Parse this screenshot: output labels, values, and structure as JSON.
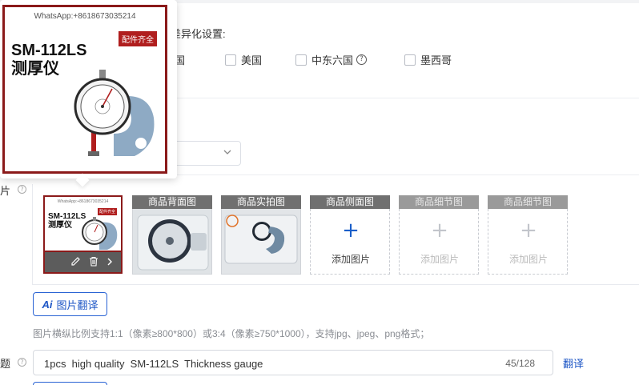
{
  "diff_settings": {
    "label": "差异化设置:"
  },
  "countries": [
    {
      "label": "韩国",
      "has_help": false
    },
    {
      "label": "美国",
      "has_help": false
    },
    {
      "label": "中东六国",
      "has_help": true
    },
    {
      "label": "墨西哥",
      "has_help": false
    }
  ],
  "side_labels": {
    "images": "片",
    "title": "题"
  },
  "image_slots": [
    {
      "label": "商品背面图",
      "state": "photo"
    },
    {
      "label": "商品实拍图",
      "state": "photo"
    },
    {
      "label": "商品侧面图",
      "state": "add",
      "action": "添加图片"
    },
    {
      "label": "商品细节图",
      "state": "disabled",
      "action": "添加图片"
    },
    {
      "label": "商品细节图",
      "state": "disabled",
      "action": "添加图片"
    }
  ],
  "main_thumb": {
    "watermark": "WhatsApp:+8618673035214",
    "badge": "配件齐全",
    "model_line1": "SM-112LS",
    "model_line2": "测厚仪"
  },
  "preview_popup": {
    "watermark": "WhatsApp:+8618673035214",
    "badge": "配件齐全",
    "model_line1": "SM-112LS",
    "model_line2": "测厚仪"
  },
  "ai_translate": {
    "ai_mark": "Ai",
    "label": "图片翻译"
  },
  "image_hint": "图片横纵比例支持1:1（像素≥800*800）或3:4（像素≥750*1000），支持jpg、jpeg、png格式；",
  "title_field": {
    "value": "1pcs  high quality  SM-112LS  Thickness gauge",
    "counter": "45/128"
  },
  "translate_link": "翻译",
  "colors": {
    "accent": "#1d56c6",
    "thumb_border": "#8b1a1a",
    "badge": "#b01e1e"
  }
}
